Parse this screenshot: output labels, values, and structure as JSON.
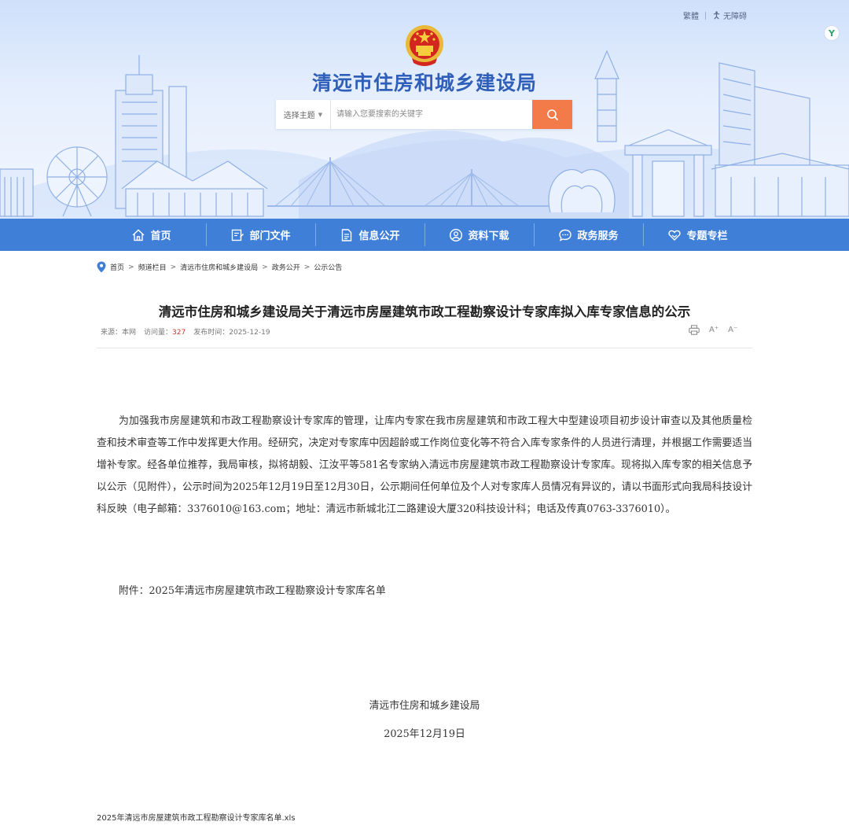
{
  "header": {
    "site_title": "清远市住房和城乡建设局",
    "top_links": {
      "traditional": "繁體",
      "accessibility": "无障碍"
    },
    "badge": "Y",
    "emblem_icon": "national-emblem-icon",
    "search": {
      "topic_label": "选择主题",
      "placeholder": "请输入您要搜索的关键字",
      "button_icon": "search-icon"
    }
  },
  "nav": {
    "items": [
      {
        "label": "首页",
        "icon": "home-icon"
      },
      {
        "label": "部门文件",
        "icon": "document-icon"
      },
      {
        "label": "信息公开",
        "icon": "file-text-icon"
      },
      {
        "label": "资料下载",
        "icon": "user-circle-icon"
      },
      {
        "label": "政务服务",
        "icon": "chat-icon"
      },
      {
        "label": "专题专栏",
        "icon": "heart-hand-icon"
      }
    ]
  },
  "breadcrumb": {
    "icon": "location-pin-icon",
    "items": [
      "首页",
      "频道栏目",
      "清远市住房和城乡建设局",
      "政务公开",
      "公示公告"
    ],
    "separator": ">"
  },
  "article": {
    "title": "清远市住房和城乡建设局关于清远市房屋建筑市政工程勘察设计专家库拟入库专家信息的公示",
    "meta": {
      "source_label": "来源：",
      "source": "本网",
      "views_label": "访问量：",
      "views": "327",
      "date_label": "发布时间：",
      "date": "2025-12-19"
    },
    "tools": {
      "print_icon": "print-icon",
      "increase_font": "A⁺",
      "decrease_font": "A⁻"
    },
    "body": "为加强我市房屋建筑和市政工程勘察设计专家库的管理，让库内专家在我市房屋建筑和市政工程大中型建设项目初步设计审查以及其他质量检查和技术审查等工作中发挥更大作用。经研究，决定对专家库中因超龄或工作岗位变化等不符合入库专家条件的人员进行清理，并根据工作需要适当增补专家。经各单位推荐，我局审核，拟将胡毅、江汝平等581名专家纳入清远市房屋建筑市政工程勘察设计专家库。现将拟入库专家的相关信息予以公示（见附件），公示时间为2025年12月19日至12月30日，公示期间任何单位及个人对专家库人员情况有异议的，请以书面形式向我局科技设计科反映（电子邮箱：3376010@163.com；地址：清远市新城北江二路建设大厦320科技设计科；电话及传真0763-3376010）。",
    "attachment_line": "附件：2025年清远市房屋建筑市政工程勘察设计专家库名单",
    "signature": "清远市住房和城乡建设局",
    "sign_date": "2025年12月19日",
    "file_link": "2025年清远市房屋建筑市政工程勘察设计专家库名单.xls"
  },
  "colors": {
    "nav_bg": "#3f7fd8",
    "title_blue": "#2f5fb8",
    "search_btn": "#f37b4a",
    "views_red": "#d0342c"
  }
}
